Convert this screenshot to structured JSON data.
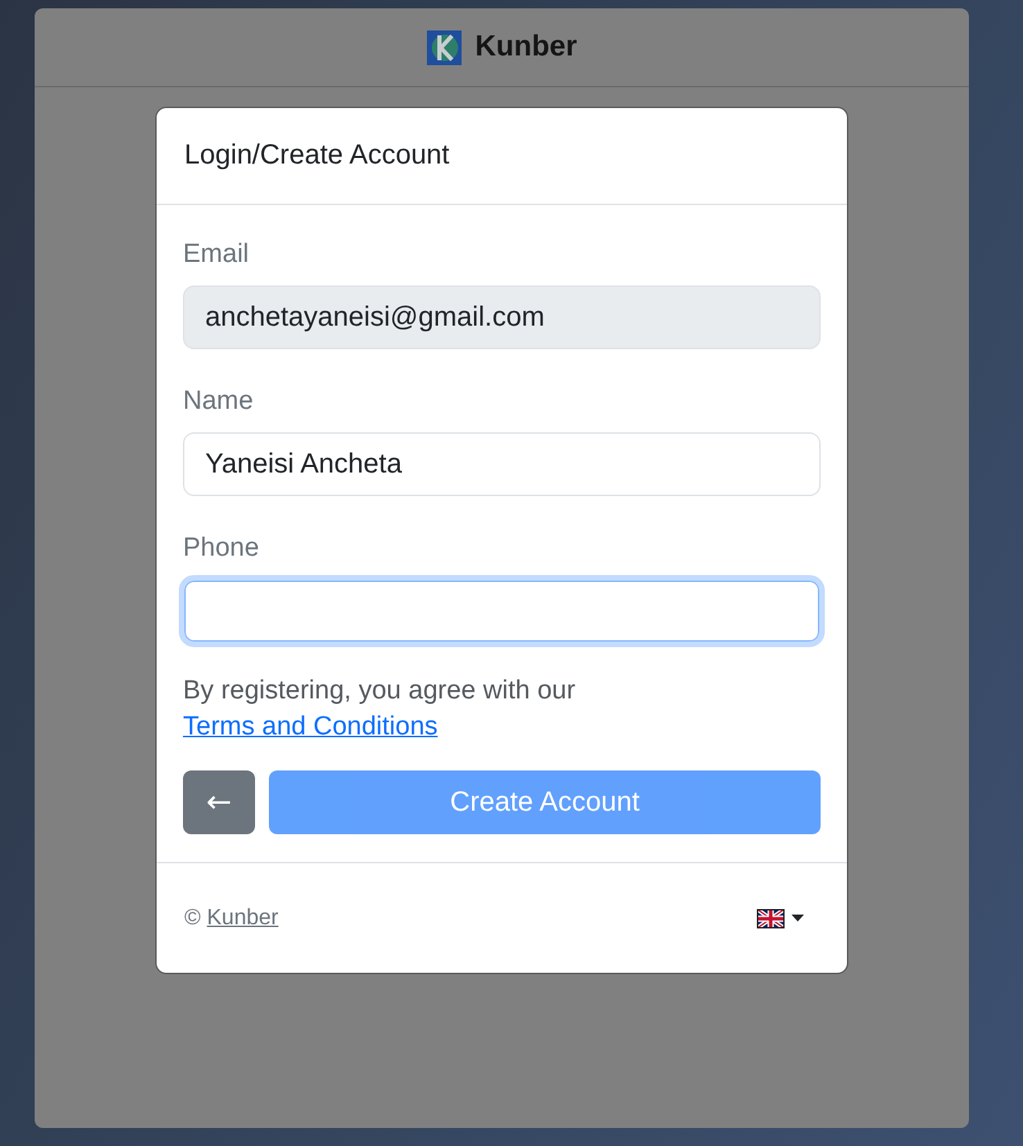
{
  "app_header": {
    "brand": "Kunber"
  },
  "dialog": {
    "title": "Login/Create Account",
    "fields": [
      {
        "label": "Email",
        "value": "anchetayaneisi@gmail.com",
        "disabled": true,
        "focused": false
      },
      {
        "label": "Name",
        "value": "Yaneisi Ancheta",
        "disabled": false,
        "focused": false
      },
      {
        "label": "Phone",
        "disabled": false,
        "focused": true
      }
    ],
    "terms": {
      "text": "By registering, you agree with our",
      "link": "Terms and Conditions"
    },
    "back_button": {
      "label": "←"
    },
    "create_button": {
      "label": "Create Account",
      "disabled": true
    },
    "footer": {
      "copyright": "©",
      "link": "Kunber"
    }
  }
}
